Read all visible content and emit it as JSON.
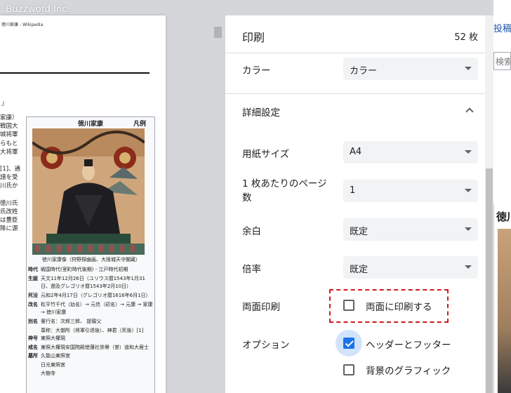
{
  "watermark": "Buzzword Inc.",
  "preview": {
    "header": "徳川家康 - Wikipedia",
    "bracket": "』",
    "body_lines": [
      "家康）",
      "戦国大",
      "城将軍",
      "らもと",
      "大将軍",
      "[1]、通",
      "譜を受",
      "川氏か",
      "徳川氏",
      "氏改姓",
      "は豊臣",
      "降に源"
    ],
    "infobox": {
      "title": "徳川家康",
      "hanrei": "凡例",
      "caption": "徳川家康像（狩野探幽画、大阪城天守閣蔵）",
      "rows": [
        {
          "key": "時代",
          "value": "戦国時代(室町時代後期) - 江戸時代初期"
        },
        {
          "key": "生誕",
          "value": "天文11年12月26日（ユリウス暦1543年1月31日、遡及グレゴリオ暦1543年2月10日）"
        },
        {
          "key": "死没",
          "value": "元和2年4月17日（グレゴリオ暦1616年6月1日）"
        },
        {
          "key": "改名",
          "value": "松平竹千代（幼名）→ 元信（初名）→ 元康 → 家康 → 徳川家康"
        },
        {
          "key": "別名",
          "value": "輩行名：次郎三郎、 提親父"
        }
      ],
      "sub_rows": [
        "尊称：大御所（将軍引退後）、神君（死後）[1]"
      ],
      "rows2": [
        {
          "key": "神号",
          "value": "東照大權現"
        },
        {
          "key": "戒名",
          "value": "東照大權現安国院殿徳蓮社崇譽（誉）道和大居士"
        },
        {
          "key": "墓所",
          "value": "久能山東照宮"
        }
      ],
      "sub_rows2": [
        "日光東照宮",
        "大樹寺"
      ]
    }
  },
  "panel": {
    "title": "印刷",
    "page_count": "52 枚",
    "color": {
      "label": "カラー",
      "value": "カラー"
    },
    "advanced": {
      "label": "詳細設定"
    },
    "paper_size": {
      "label": "用紙サイズ",
      "value": "A4"
    },
    "pages_per_sheet": {
      "label_line1": "1 枚あたりのページ",
      "label_line2": "数",
      "value": "1"
    },
    "margins": {
      "label": "余白",
      "value": "既定"
    },
    "scale": {
      "label": "倍率",
      "value": "既定"
    },
    "duplex": {
      "label": "両面印刷",
      "checkbox_label": "両面に印刷する",
      "checked": false
    },
    "options": {
      "label": "オプション",
      "headers_footers": {
        "label": "ヘッダーとフッター",
        "checked": true
      },
      "background_graphics": {
        "label": "背景のグラフィック",
        "checked": false
      }
    }
  },
  "background": {
    "top_text": "投稿記",
    "search_text": "検索",
    "page_title": "徳川"
  },
  "colors": {
    "accent": "#1a73e8",
    "highlight": "#d21a1a"
  }
}
